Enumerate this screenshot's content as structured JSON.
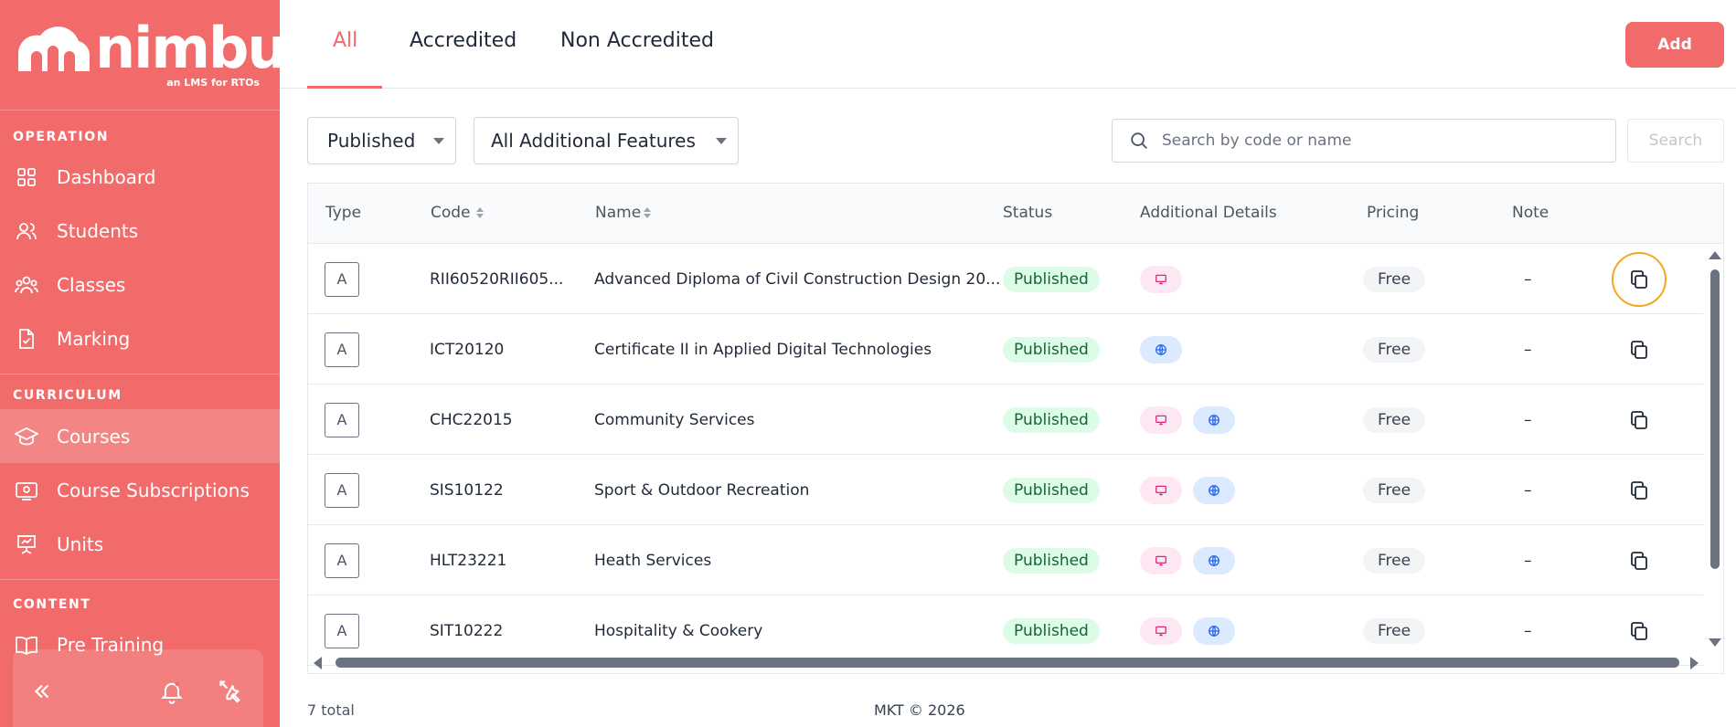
{
  "brand": {
    "name": "nimbu",
    "tagline": "an LMS for RTOs"
  },
  "sidebar": {
    "sections": {
      "operation": "OPERATION",
      "curriculum": "CURRICULUM",
      "content": "CONTENT"
    },
    "items": [
      {
        "label": "Dashboard",
        "icon": "grid-icon",
        "active": false
      },
      {
        "label": "Students",
        "icon": "users-icon",
        "active": false
      },
      {
        "label": "Classes",
        "icon": "group-icon",
        "active": false
      },
      {
        "label": "Marking",
        "icon": "file-check-icon",
        "active": false
      },
      {
        "label": "Courses",
        "icon": "graduation-cap-icon",
        "active": true
      },
      {
        "label": "Course Subscriptions",
        "icon": "id-card-icon",
        "active": false
      },
      {
        "label": "Units",
        "icon": "presentation-icon",
        "active": false
      },
      {
        "label": "Pre Training",
        "icon": "book-open-icon",
        "active": false
      }
    ]
  },
  "tabs": [
    {
      "label": "All",
      "active": true
    },
    {
      "label": "Accredited",
      "active": false
    },
    {
      "label": "Non Accredited",
      "active": false
    }
  ],
  "toolbar": {
    "add_label": "Add"
  },
  "filters": {
    "status_value": "Published",
    "features_value": "All Additional Features"
  },
  "search": {
    "placeholder": "Search by code or name",
    "button_label": "Search"
  },
  "table": {
    "columns": [
      "Type",
      "Code",
      "Name",
      "Status",
      "Additional Details",
      "Pricing",
      "Note"
    ],
    "rows": [
      {
        "type": "A",
        "code": "RII60520RII605...",
        "name": "Advanced Diploma of Civil Construction Design 20...",
        "status": "Published",
        "details": [
          "monitor"
        ],
        "pricing": "Free",
        "note": "–"
      },
      {
        "type": "A",
        "code": "ICT20120",
        "name": "Certificate II in Applied Digital Technologies",
        "status": "Published",
        "details": [
          "globe"
        ],
        "pricing": "Free",
        "note": "–"
      },
      {
        "type": "A",
        "code": "CHC22015",
        "name": "Community Services",
        "status": "Published",
        "details": [
          "monitor",
          "globe"
        ],
        "pricing": "Free",
        "note": "–"
      },
      {
        "type": "A",
        "code": "SIS10122",
        "name": "Sport & Outdoor Recreation",
        "status": "Published",
        "details": [
          "monitor",
          "globe"
        ],
        "pricing": "Free",
        "note": "–"
      },
      {
        "type": "A",
        "code": "HLT23221",
        "name": "Heath Services",
        "status": "Published",
        "details": [
          "monitor",
          "globe"
        ],
        "pricing": "Free",
        "note": "–"
      },
      {
        "type": "A",
        "code": "SIT10222",
        "name": "Hospitality & Cookery",
        "status": "Published",
        "details": [
          "monitor",
          "globe"
        ],
        "pricing": "Free",
        "note": "–"
      }
    ]
  },
  "footer": {
    "total": "7 total",
    "copyright": "MKT © 2026"
  },
  "colors": {
    "brand": "#f26b6b",
    "status_bg": "#dcfce7",
    "status_text": "#166534",
    "focus_ring": "#f5a623"
  }
}
